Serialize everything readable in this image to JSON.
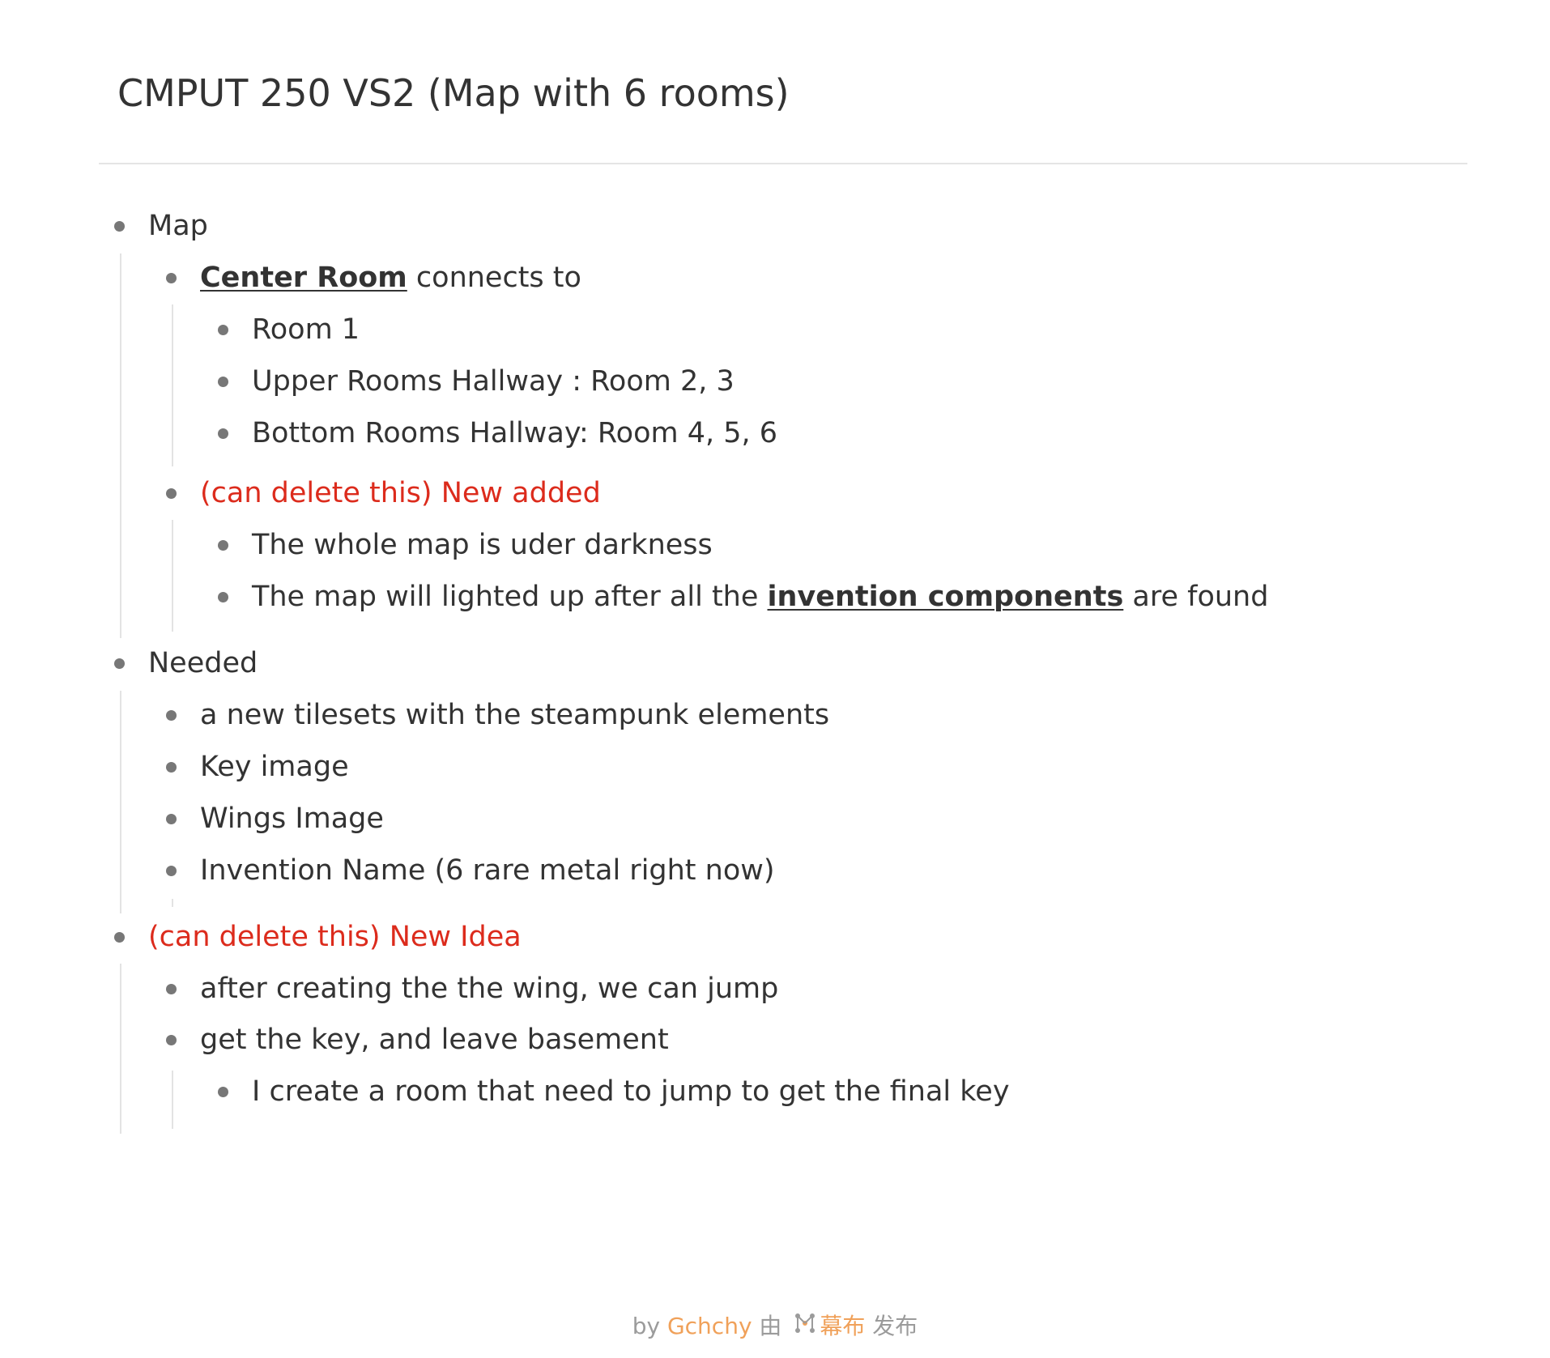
{
  "document": {
    "title": "CMPUT 250 VS2 (Map with 6 rooms)"
  },
  "outline": {
    "map": {
      "label": "Map",
      "center_room": {
        "link": "Center Room",
        "text": " connects to",
        "children": [
          "Room 1",
          "Upper Rooms Hallway : Room 2, 3",
          "Bottom Rooms Hallway: Room 4, 5, 6"
        ]
      },
      "new_added": {
        "label": "(can delete this) New added",
        "child_1": "The whole map is uder darkness",
        "child_2_before": "The map will lighted up after all the ",
        "child_2_link": "invention components",
        "child_2_after": " are found"
      }
    },
    "needed": {
      "label": "Needed",
      "children": [
        "a new tilesets with the steampunk elements",
        "Key image",
        "Wings Image",
        "Invention Name (6 rare metal right now)"
      ]
    },
    "new_idea": {
      "label": "(can delete this) New Idea",
      "child_1": "after creating the the wing, we can jump",
      "child_2": "get the key, and leave basement",
      "child_2_sub": "I create a room that need to jump to get the final key"
    }
  },
  "footer": {
    "prefix": "by ",
    "author": "Gchchy",
    "middle": " 由 ",
    "logo_icon": "mubu-logo-icon",
    "brand": "幕布",
    "suffix": " 发布"
  },
  "colors": {
    "text": "#333333",
    "highlight_red": "#dc2b1c",
    "footer_accent": "#f0a15a",
    "footer_gray": "#9b9b9b"
  }
}
